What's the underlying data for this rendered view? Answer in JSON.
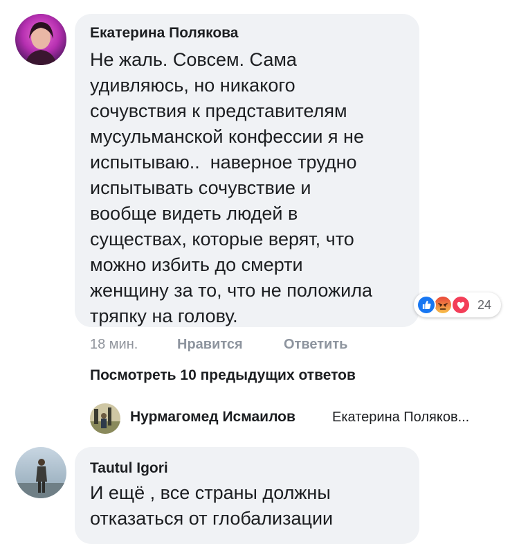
{
  "comment1": {
    "author": "Екатерина Полякова",
    "text_lines": [
      "Не жаль. Совсем. Сама",
      "удивляюсь, но никакого",
      "сочувствия к представителям",
      "мусульманской конфессии я не",
      "испытываю..  наверное трудно",
      "испытывать сочувствие и",
      "вообще видеть людей в",
      "существах, которые верят, что",
      "можно избить до смерти",
      "женщину за то, что не положила",
      "тряпку на голову."
    ],
    "time": "18 мин.",
    "like_label": "Нравится",
    "reply_label": "Ответить",
    "reactions": {
      "icons": [
        "like-reaction",
        "angry-reaction",
        "love-reaction"
      ],
      "count": "24",
      "colors": {
        "like": "#1877f2",
        "angry": "#f0663a",
        "love": "#f33e58"
      }
    }
  },
  "view_previous_replies": "Посмотреть 10 предыдущих ответов",
  "reply_preview": {
    "author": "Нурмагомед Исмаилов",
    "text": "Екатерина Поляков..."
  },
  "comment2": {
    "author": "Tautul Igori",
    "text_lines": [
      "И ещё , все страны должны",
      "отказаться от глобализации"
    ]
  },
  "colors": {
    "bubble": "#f0f2f5",
    "muted_text": "#90949c",
    "primary_text": "#1c1e21"
  }
}
